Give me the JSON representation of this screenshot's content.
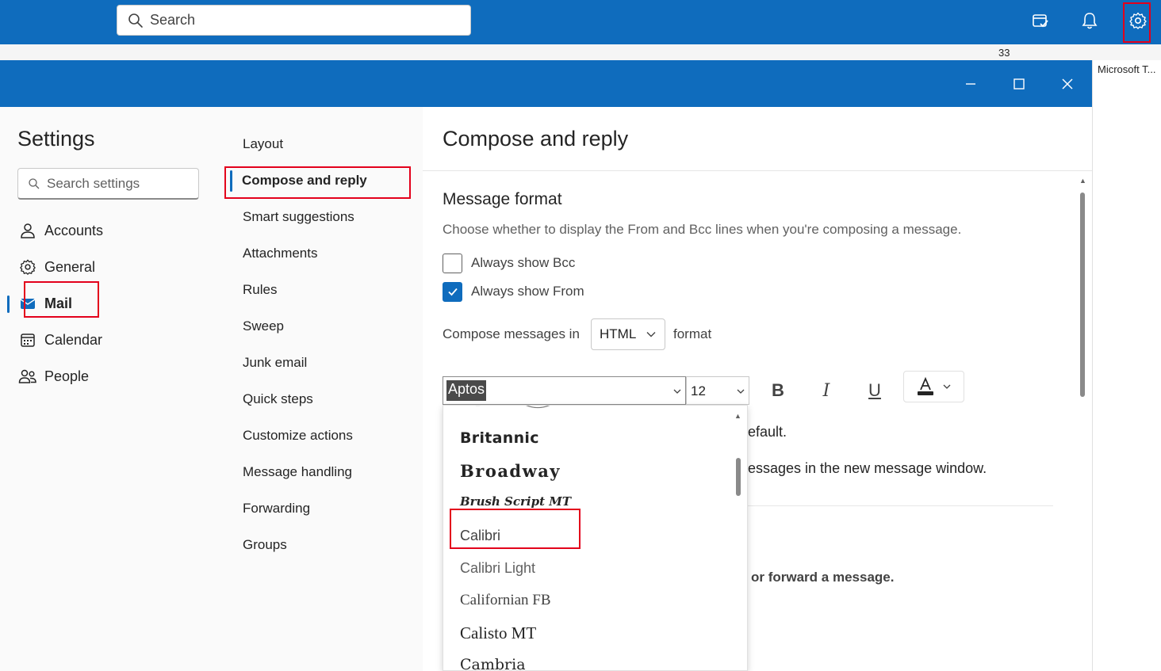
{
  "topbar": {
    "search_placeholder": "Search",
    "icons": [
      "task-icon",
      "bell-icon",
      "gear-icon"
    ]
  },
  "behind": {
    "count": "33",
    "right_panel_text": "Microsoft T..."
  },
  "dialog": {
    "window_controls": [
      "minimize",
      "maximize",
      "close"
    ]
  },
  "settings": {
    "title": "Settings",
    "search_placeholder": "Search settings",
    "nav": [
      {
        "label": "Accounts",
        "icon": "person-icon"
      },
      {
        "label": "General",
        "icon": "gear-icon"
      },
      {
        "label": "Mail",
        "icon": "mail-icon",
        "selected": true
      },
      {
        "label": "Calendar",
        "icon": "calendar-icon"
      },
      {
        "label": "People",
        "icon": "people-icon"
      }
    ]
  },
  "mail_sub": {
    "items": [
      "Layout",
      "Compose and reply",
      "Smart suggestions",
      "Attachments",
      "Rules",
      "Sweep",
      "Junk email",
      "Quick steps",
      "Customize actions",
      "Message handling",
      "Forwarding",
      "Groups"
    ],
    "selected_index": 1
  },
  "content": {
    "page_title": "Compose and reply",
    "section_title": "Message format",
    "section_desc": "Choose whether to display the From and Bcc lines when you're composing a message.",
    "checkboxes": [
      {
        "label": "Always show Bcc",
        "checked": false
      },
      {
        "label": "Always show From",
        "checked": true
      }
    ],
    "compose_label": "Compose messages in",
    "compose_format": "HTML",
    "format_label": "format",
    "font_value": "Aptos",
    "size_value": "12",
    "toolbar": {
      "bold": "B",
      "italic": "I",
      "underline": "U"
    },
    "bg_text_1": "efault.",
    "bg_text_2": "essages in the new message window.",
    "bg_text_3": "or forward a message."
  },
  "font_list": {
    "items": [
      {
        "label": "Britannic"
      },
      {
        "label": "Broadway"
      },
      {
        "label": "Brush Script MT"
      },
      {
        "label": "Calibri"
      },
      {
        "label": "Calibri Light"
      },
      {
        "label": "Californian FB"
      },
      {
        "label": "Calisto MT"
      },
      {
        "label": "Cambria"
      }
    ]
  },
  "colors": {
    "accent": "#0f6cbd",
    "highlight": "#e3001b"
  }
}
